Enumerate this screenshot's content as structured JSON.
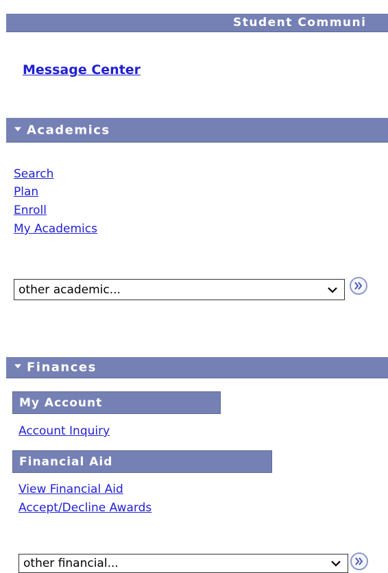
{
  "header": {
    "title": "Student Communi"
  },
  "message_center": {
    "label": "Message Center"
  },
  "academics": {
    "title": "Academics",
    "links": [
      "Search",
      "Plan",
      "Enroll",
      "My Academics"
    ],
    "select_value": "other academic..."
  },
  "finances": {
    "title": "Finances",
    "my_account": {
      "title": "My Account",
      "links": [
        "Account Inquiry"
      ]
    },
    "financial_aid": {
      "title": "Financial Aid",
      "links": [
        "View Financial Aid",
        "Accept/Decline Awards"
      ]
    },
    "select_value": "other financial..."
  },
  "icons": {
    "section_toggle": "triangle-down-icon",
    "go": "double-chevron-right-icon",
    "dropdown": "chevron-down-icon"
  },
  "colors": {
    "header_bar": "#7581b5",
    "link": "#1f1fd4",
    "go_ring": "#8d98cd"
  }
}
